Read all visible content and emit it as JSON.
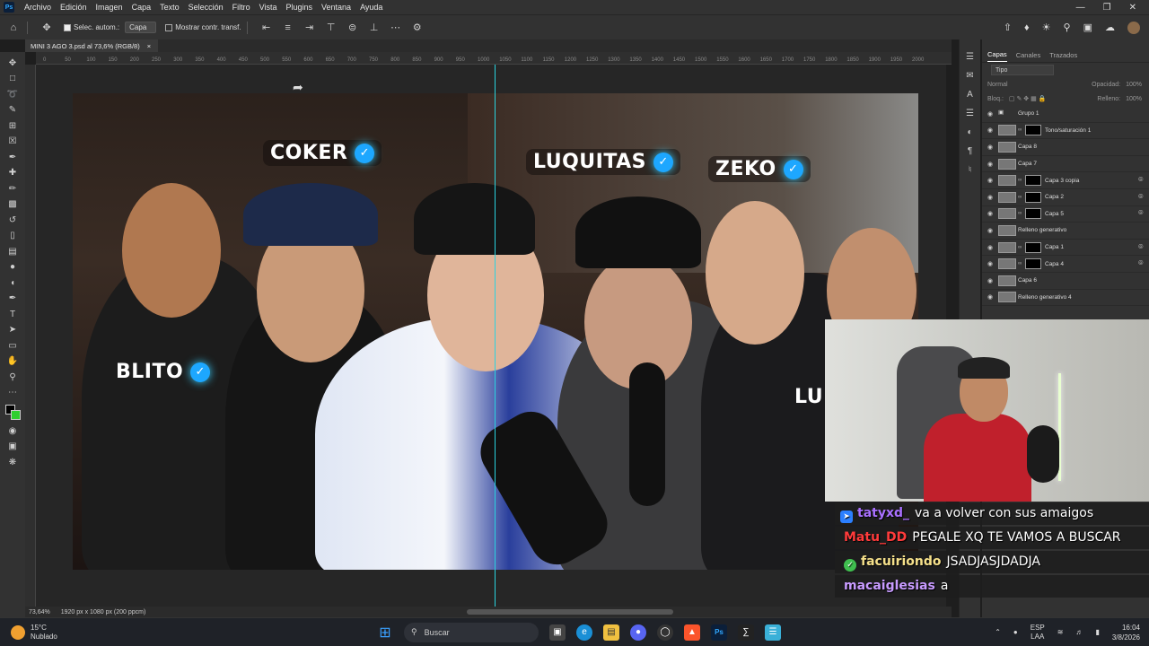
{
  "menubar": {
    "items": [
      "Archivo",
      "Edición",
      "Imagen",
      "Capa",
      "Texto",
      "Selección",
      "Filtro",
      "Vista",
      "Plugins",
      "Ventana",
      "Ayuda"
    ],
    "logo": "Ps"
  },
  "options": {
    "auto_select_label": "Selec. autom.:",
    "auto_select_value": "Capa",
    "show_transform_label": "Mostrar contr. transf."
  },
  "document": {
    "tab_title": "MINI 3 AGO 3.psd al 73,6% (RGB/8)",
    "close": "×",
    "zoom": "73,64%",
    "size_info": "1920 px x 1080 px (200 ppcm)"
  },
  "ruler": [
    "0",
    "50",
    "100",
    "150",
    "200",
    "250",
    "300",
    "350",
    "400",
    "450",
    "500",
    "550",
    "600",
    "650",
    "700",
    "750",
    "800",
    "850",
    "900",
    "950",
    "1000",
    "1050",
    "1100",
    "1150",
    "1200",
    "1250",
    "1300",
    "1350",
    "1400",
    "1450",
    "1500",
    "1550",
    "1600",
    "1650",
    "1700",
    "1750",
    "1800",
    "1850",
    "1900",
    "1950",
    "2000"
  ],
  "thumbnail": {
    "names": [
      {
        "text": "COKER"
      },
      {
        "text": "LUQUITAS"
      },
      {
        "text": "ZEKO"
      },
      {
        "text": "BLITO"
      },
      {
        "text": "LU"
      }
    ]
  },
  "layers_panel": {
    "tabs": [
      "Capas",
      "Canales",
      "Trazados"
    ],
    "filter_label": "Tipo",
    "blend_mode": "Normal",
    "opacity_label": "Opacidad:",
    "opacity_value": "100%",
    "lock_label": "Bloq.:",
    "fill_label": "Relleno:",
    "fill_value": "100%",
    "layers": [
      {
        "name": "Grupo 1"
      },
      {
        "name": "Tono/saturación 1"
      },
      {
        "name": "Capa 8"
      },
      {
        "name": "Capa 7"
      },
      {
        "name": "Capa 3 copia"
      },
      {
        "name": "Capa 2"
      },
      {
        "name": "Capa 5"
      },
      {
        "name": "Relleno generativo"
      },
      {
        "name": "Capa 1"
      },
      {
        "name": "Capa 4"
      },
      {
        "name": "Capa 6"
      },
      {
        "name": "Relleno generativo 4"
      }
    ]
  },
  "chat": [
    {
      "user": "tatyxd_",
      "user_color": "#a970ff",
      "text": "va a volver con sus amaigos",
      "badge": "prime-icon",
      "badge_color": "#2b7fff"
    },
    {
      "user": "Matu_DD",
      "user_color": "#ff3b3b",
      "text": "PEGALE XQ TE VAMOS A BUSCAR",
      "badge": "",
      "badge_color": ""
    },
    {
      "user": "facuiriondo",
      "user_color": "#f5e08a",
      "text": "JSADJASJDADJA",
      "badge": "check-icon",
      "badge_color": "#3fbf4f"
    },
    {
      "user": "macaiglesias",
      "user_color": "#c89bff",
      "text": "a",
      "badge": "",
      "badge_color": ""
    }
  ],
  "taskbar": {
    "temperature": "15°C",
    "weather": "Nublado",
    "search_placeholder": "Buscar",
    "language": "ESP",
    "layout": "LAA",
    "time": "16:04",
    "date": "3/8/2026"
  },
  "colors": {
    "guide": "#2ad3e0",
    "verified": "#1da7ff",
    "fg": "#000000",
    "bg_swatch": "#2fcf2f"
  }
}
